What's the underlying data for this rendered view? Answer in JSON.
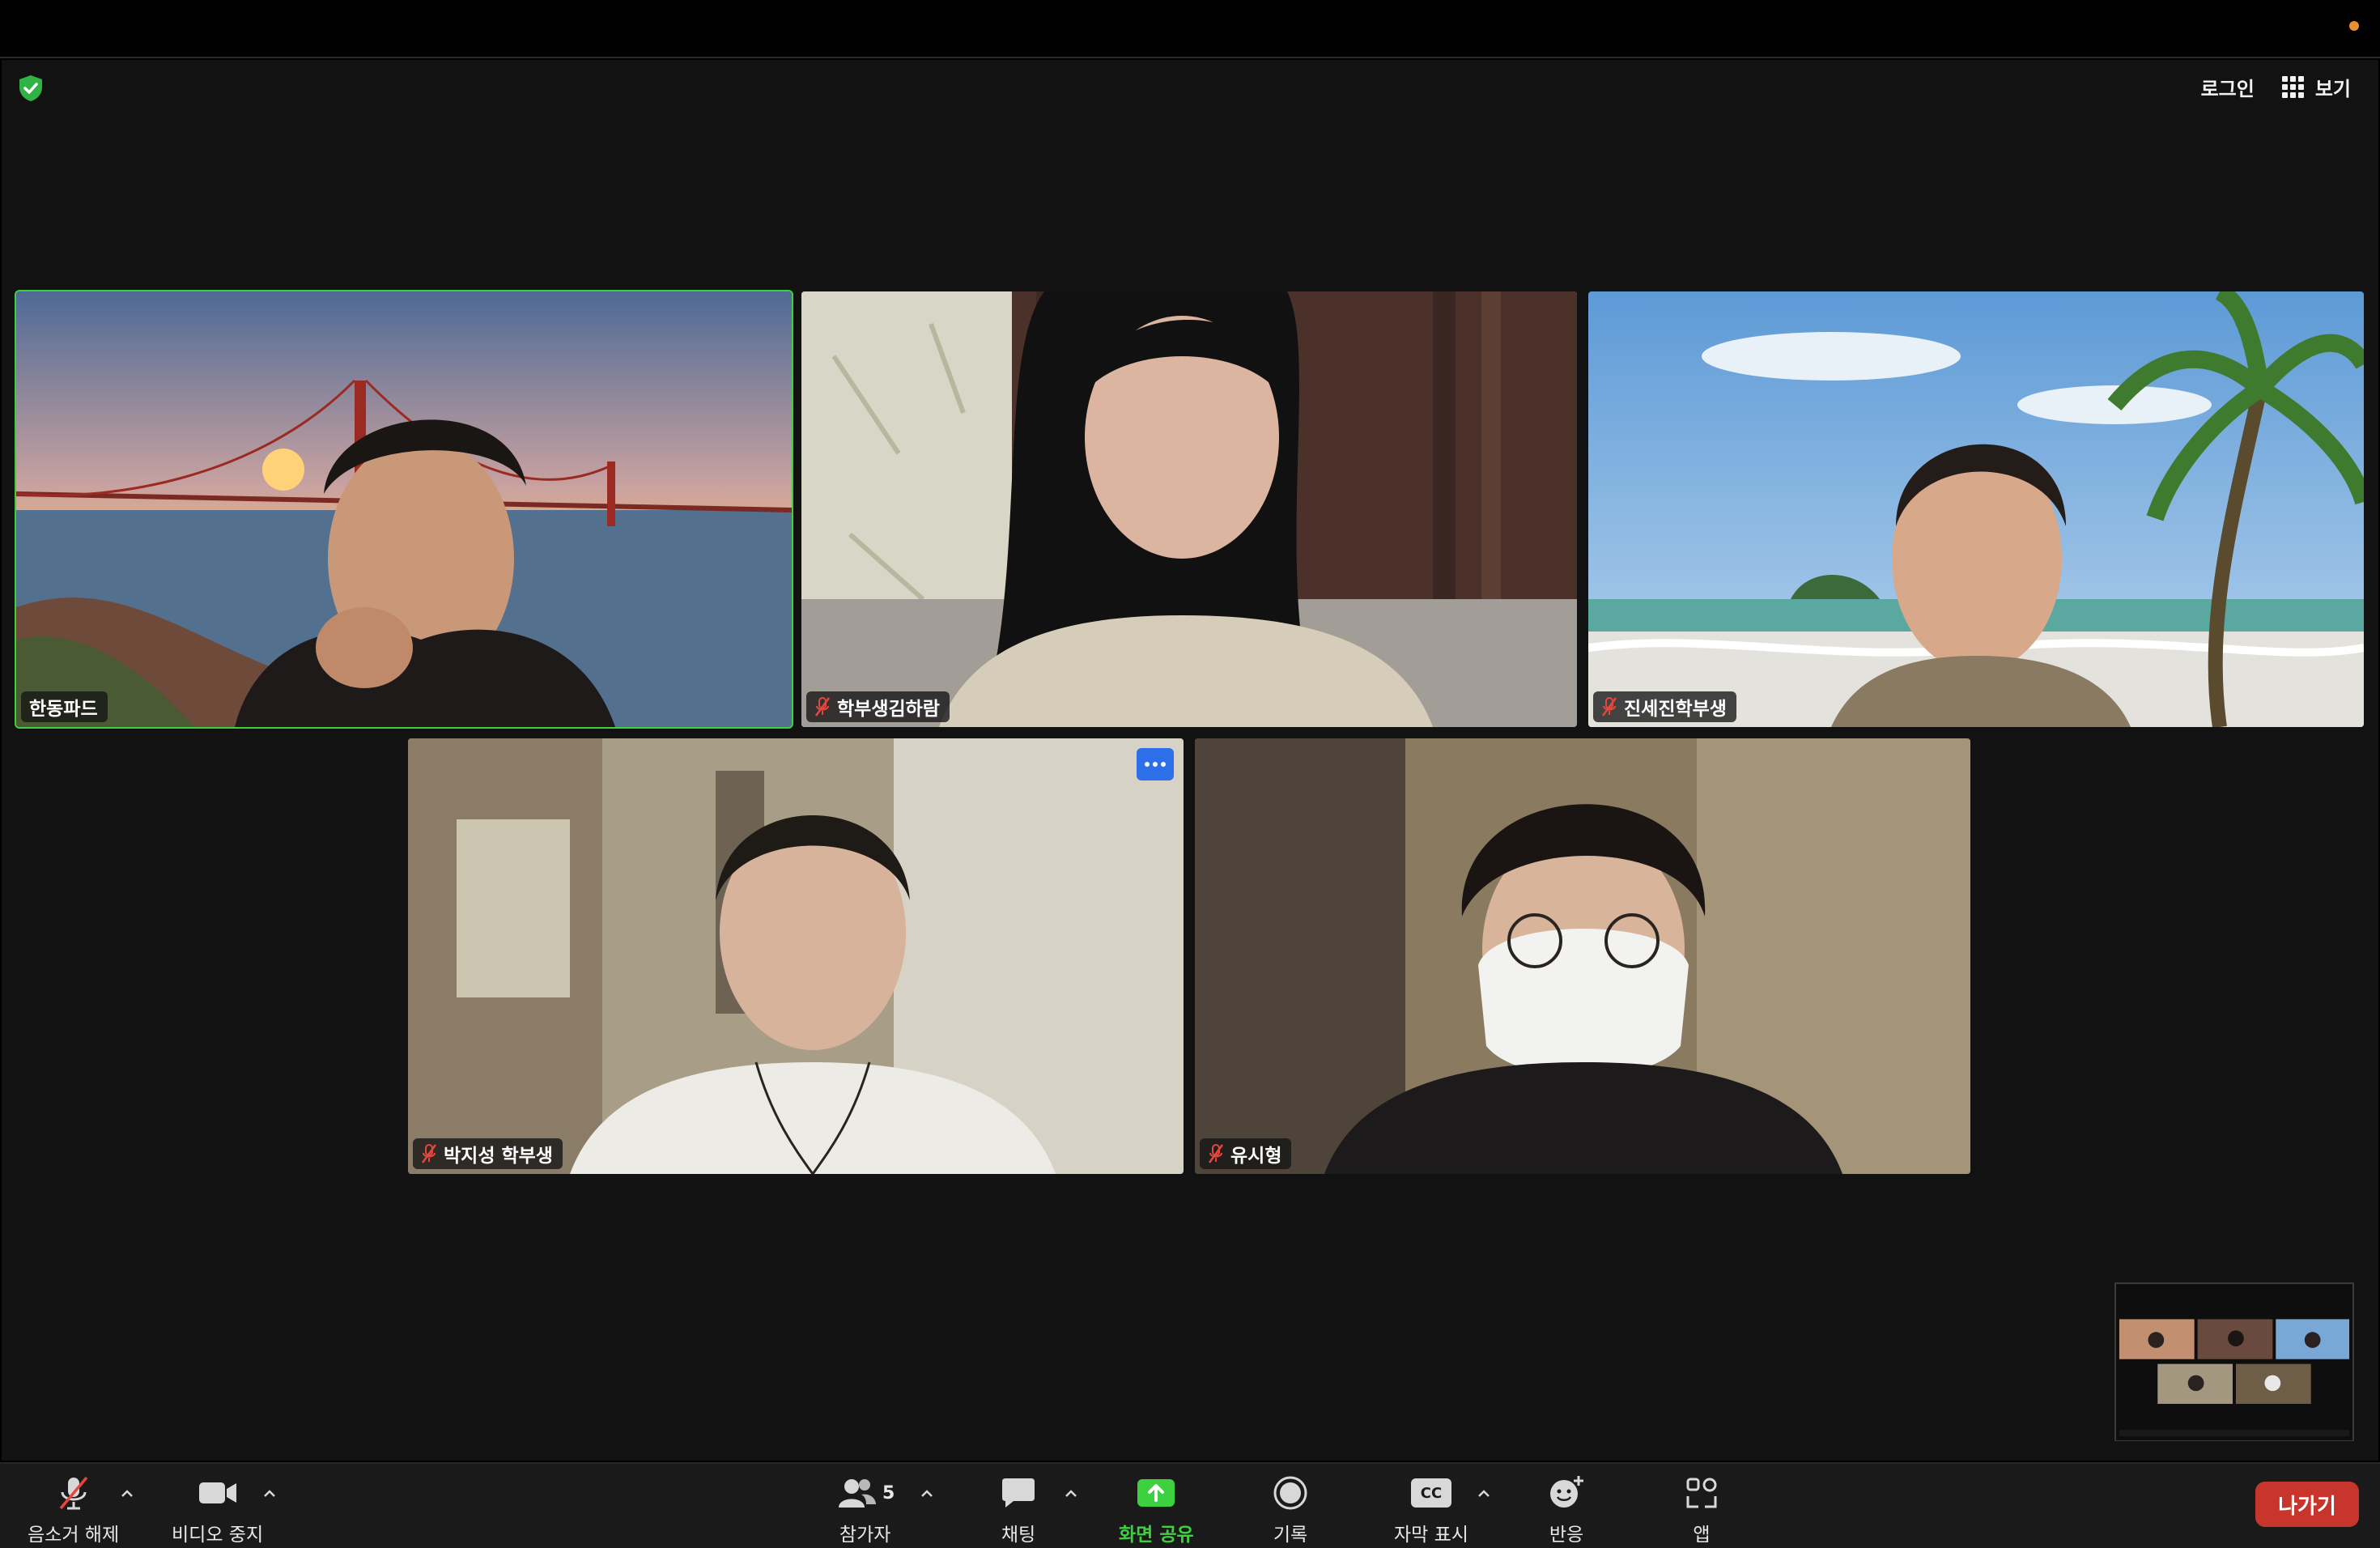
{
  "header": {
    "login_label": "로그인",
    "view_label": "보기"
  },
  "participants": [
    {
      "name": "한동파드",
      "muted": false,
      "active_speaker": true
    },
    {
      "name": "학부생김하람",
      "muted": true,
      "active_speaker": false
    },
    {
      "name": "진세진학부생",
      "muted": true,
      "active_speaker": false
    },
    {
      "name": "박지성 학부생",
      "muted": true,
      "active_speaker": false
    },
    {
      "name": "유시형",
      "muted": true,
      "active_speaker": false
    }
  ],
  "toolbar": {
    "unmute_label": "음소거 해제",
    "stop_video_label": "비디오 중지",
    "participants_label": "참가자",
    "participants_count": "5",
    "chat_label": "채팅",
    "share_label": "화면 공유",
    "record_label": "기록",
    "captions_label": "자막 표시",
    "captions_badge": "CC",
    "reactions_label": "반응",
    "apps_label": "앱",
    "leave_label": "나가기"
  },
  "colors": {
    "active_speaker_border": "#3ed13f",
    "share_green": "#3ed13f",
    "leave_red": "#c8352c",
    "more_button_blue": "#2d6fe8",
    "security_shield": "#2fb344"
  }
}
